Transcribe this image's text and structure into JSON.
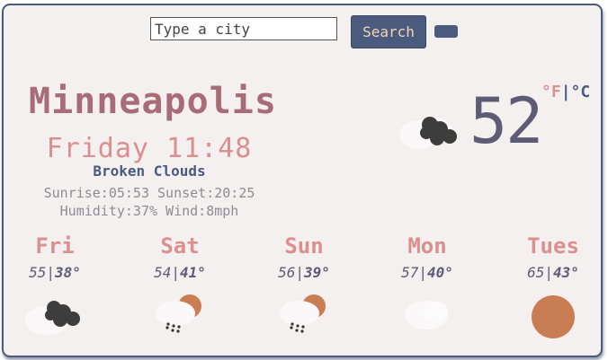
{
  "search": {
    "placeholder": "Type a city",
    "button_label": "Search"
  },
  "current": {
    "city": "Minneapolis",
    "datetime": "Friday 11:48",
    "condition": "Broken Clouds",
    "sun": "Sunrise:05:53 Sunset:20:25",
    "humidity_wind": "Humidity:37% Wind:8mph",
    "temperature": "52",
    "icon": "broken-clouds-icon"
  },
  "units": {
    "f": "°F",
    "sep": "|",
    "c": "°C"
  },
  "forecast": [
    {
      "day": "Fri",
      "high": "55",
      "sep": "|",
      "low": "38°",
      "icon": "broken-clouds-icon"
    },
    {
      "day": "Sat",
      "high": "54",
      "sep": "|",
      "low": "41°",
      "icon": "sun-rain-icon"
    },
    {
      "day": "Sun",
      "high": "56",
      "sep": "|",
      "low": "39°",
      "icon": "sun-rain-icon"
    },
    {
      "day": "Mon",
      "high": "57",
      "sep": "|",
      "low": "40°",
      "icon": "few-clouds-icon"
    },
    {
      "day": "Tues",
      "high": "65",
      "sep": "|",
      "low": "43°",
      "icon": "sun-icon"
    }
  ],
  "colors": {
    "accent": "#4b5b7e",
    "pink": "#d9908f",
    "city": "#a86c78",
    "sun": "#c97d52",
    "background": "#f4f0ef"
  }
}
